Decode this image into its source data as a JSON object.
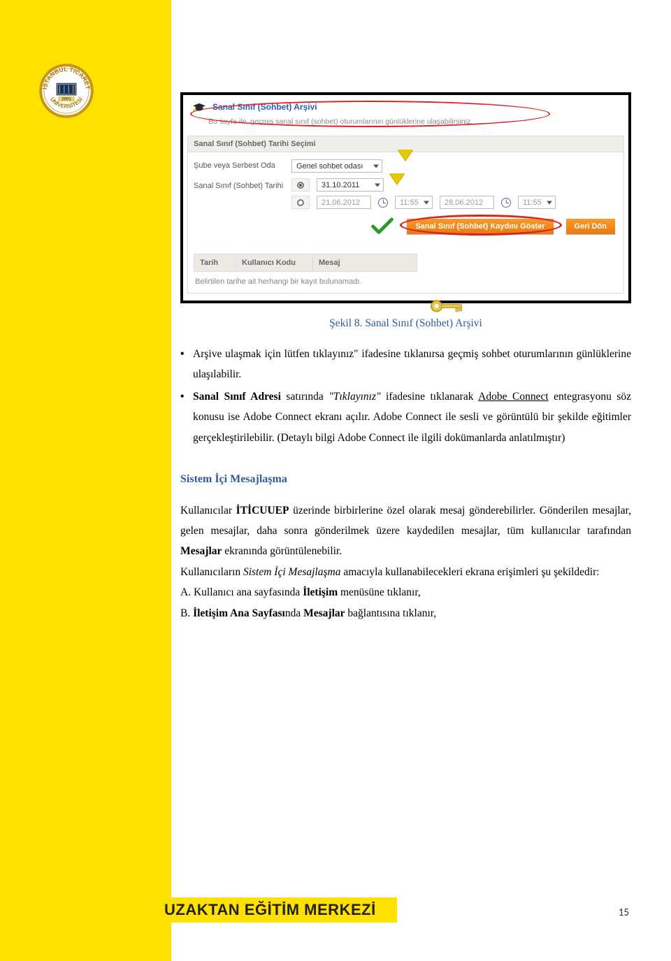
{
  "logo_alt": "İstanbul Ticaret Üniversitesi",
  "screenshot": {
    "panel_title": "Sanal Sınıf (Sohbet) Arşivi",
    "panel_sub": "Bu sayfa ile, geçmiş sanal sınıf (sohbet) oturumlarının günlüklerine ulaşabilirsiniz.",
    "date_panel": "Sanal Sınıf (Sohbet) Tarihi Seçimi",
    "label_room": "Şube veya Serbest Oda",
    "label_date": "Sanal Sınıf (Sohbet) Tarihi",
    "room_selected": "Genel sohbet odası",
    "date_selected": "31.10.2011",
    "range_start_date": "21.06.2012",
    "range_start_time": "11:55",
    "range_end_date": "28.06.2012",
    "range_end_time": "11:55",
    "btn_show": "Sanal Sınıf (Sohbet) Kaydını Göster",
    "btn_back": "Geri Dön",
    "col_date": "Tarih",
    "col_user": "Kullanıcı Kodu",
    "col_msg": "Mesaj",
    "no_results": "Belirtilen tarihe ait herhangi bir kayıt bulunamadı."
  },
  "figure_caption": "Şekil 8. Sanal Sınıf (Sohbet) Arşivi",
  "paragraphs": {
    "bullet1_a": "Arşive ulaşmak için lütfen tıklayınız\" ifadesine tıklanırsa geçmiş sohbet oturumlarının günlüklerine ulaşılabilir.",
    "bullet2_a": "Sanal Sınıf Adresi",
    "bullet2_b": " satırında ",
    "bullet2_c": "\"Tıklayınız\"",
    "bullet2_d": " ifadesine tıklanarak ",
    "bullet2_e": "Adobe Connect",
    "bullet2_f": " entegrasyonu söz konusu ise Adobe Connect ekranı açılır. Adobe Connect ile sesli ve görüntülü bir şekilde eğitimler gerçekleştirilebilir. (Detaylı bilgi Adobe Connect ile ilgili dokümanlarda anlatılmıştır)"
  },
  "section_title": "Sistem İçi Mesajlaşma",
  "section_body": {
    "p1_a": "Kullanıcılar ",
    "p1_b": "İTİCUUEP",
    "p1_c": " üzerinde birbirlerine özel olarak mesaj gönderebilirler. Gönderilen mesajlar, gelen mesajlar, daha sonra gönderilmek üzere kaydedilen mesajlar, tüm kullanıcılar tarafından ",
    "p1_d": "Mesajlar",
    "p1_e": " ekranında görüntülenebilir.",
    "p2_a": "Kullanıcıların ",
    "p2_b": "Sistem İçi Mesajlaşma",
    "p2_c": " amacıyla kullanabilecekleri ekrana erişimleri şu şekildedir:",
    "pA_a": "A. Kullanıcı ana sayfasında ",
    "pA_b": "İletişim",
    "pA_c": " menüsüne tıklanır,",
    "pB_a": "B. ",
    "pB_b": "İletişim Ana Sayfası",
    "pB_c": "nda ",
    "pB_d": "Mesajlar",
    "pB_e": " bağlantısına tıklanır,"
  },
  "footer": "UZAKTAN EĞİTİM MERKEZİ",
  "page_number": "15"
}
